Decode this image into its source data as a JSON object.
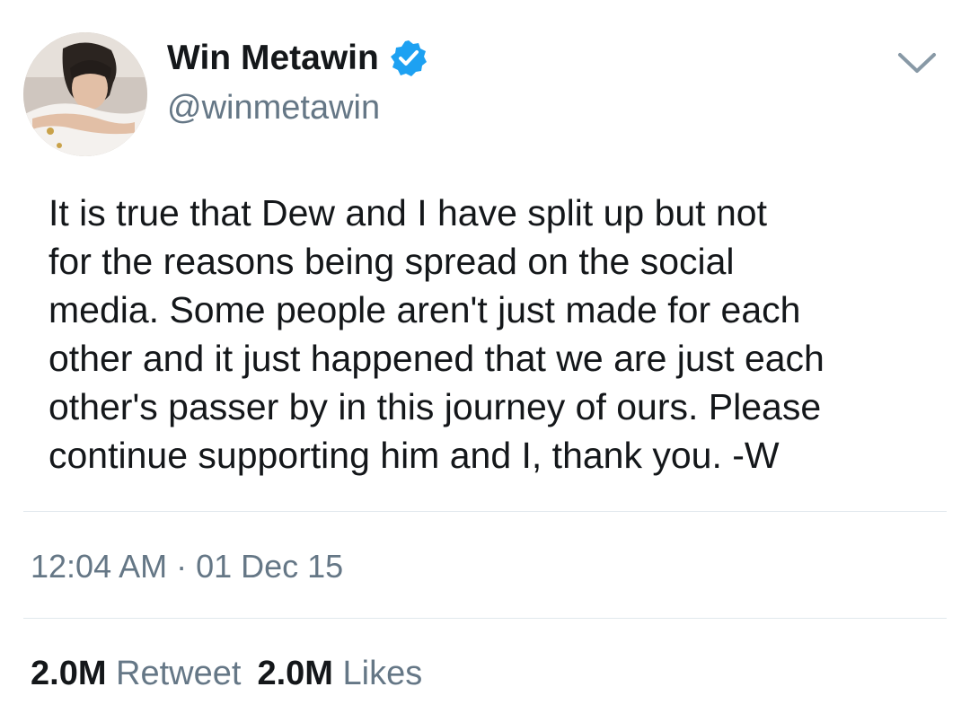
{
  "tweet": {
    "author": {
      "display_name": "Win Metawin",
      "handle": "@winmetawin",
      "verified": true
    },
    "text": "It is true that Dew and I have split up but not\nfor the reasons being spread on the social\nmedia. Some people aren't just made for each\nother and it just happened that we are just each\nother's passer by in this journey of ours. Please\ncontinue supporting him and I, thank you. -W",
    "timestamp": "12:04 AM · 01 Dec 15",
    "stats": {
      "retweets_count": "2.0M",
      "retweets_label": "Retweet",
      "likes_count": "2.0M",
      "likes_label": "Likes"
    }
  },
  "icons": {
    "verified": "verified-badge-icon",
    "menu": "chevron-down-icon"
  },
  "colors": {
    "verified_blue": "#1da1f2",
    "secondary_text": "#657786",
    "primary_text": "#14171a",
    "divider": "#e1e8ed"
  }
}
